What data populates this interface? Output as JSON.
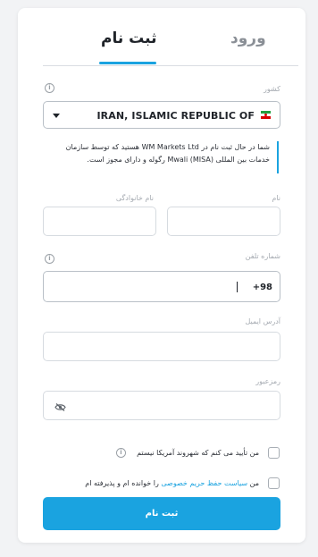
{
  "tabs": {
    "login": "ورود",
    "register": "ثبت نام"
  },
  "country": {
    "label": "کشور",
    "value": "IRAN, ISLAMIC REPUBLIC OF"
  },
  "notice": {
    "text": "شما در حال ثبت نام در WM Markets Ltd هستید که توسط سازمان خدمات بین المللی Mwali (MISA) رگوله و دارای مجوز است."
  },
  "form": {
    "first_name_label": "نام",
    "last_name_label": "نام خانوادگی",
    "phone_label": "شماره تلفن",
    "phone_code": "+98",
    "email_label": "آدرس ایمیل",
    "password_label": "رمزعبور"
  },
  "checks": {
    "us_citizen": "من تأیید می کنم که شهروند آمریکا نیستم",
    "privacy_prefix": "من ",
    "privacy_link": "سیاست حفظ حریم خصوصی",
    "privacy_suffix": " را خوانده ام و پذیرفته ام"
  },
  "submit_label": "ثبت نام",
  "colors": {
    "accent": "#1aa3e0",
    "border": "#d6dbe0"
  },
  "icons": [
    "info-icon",
    "iran-flag-icon",
    "caret-down-icon",
    "eye-off-icon"
  ]
}
